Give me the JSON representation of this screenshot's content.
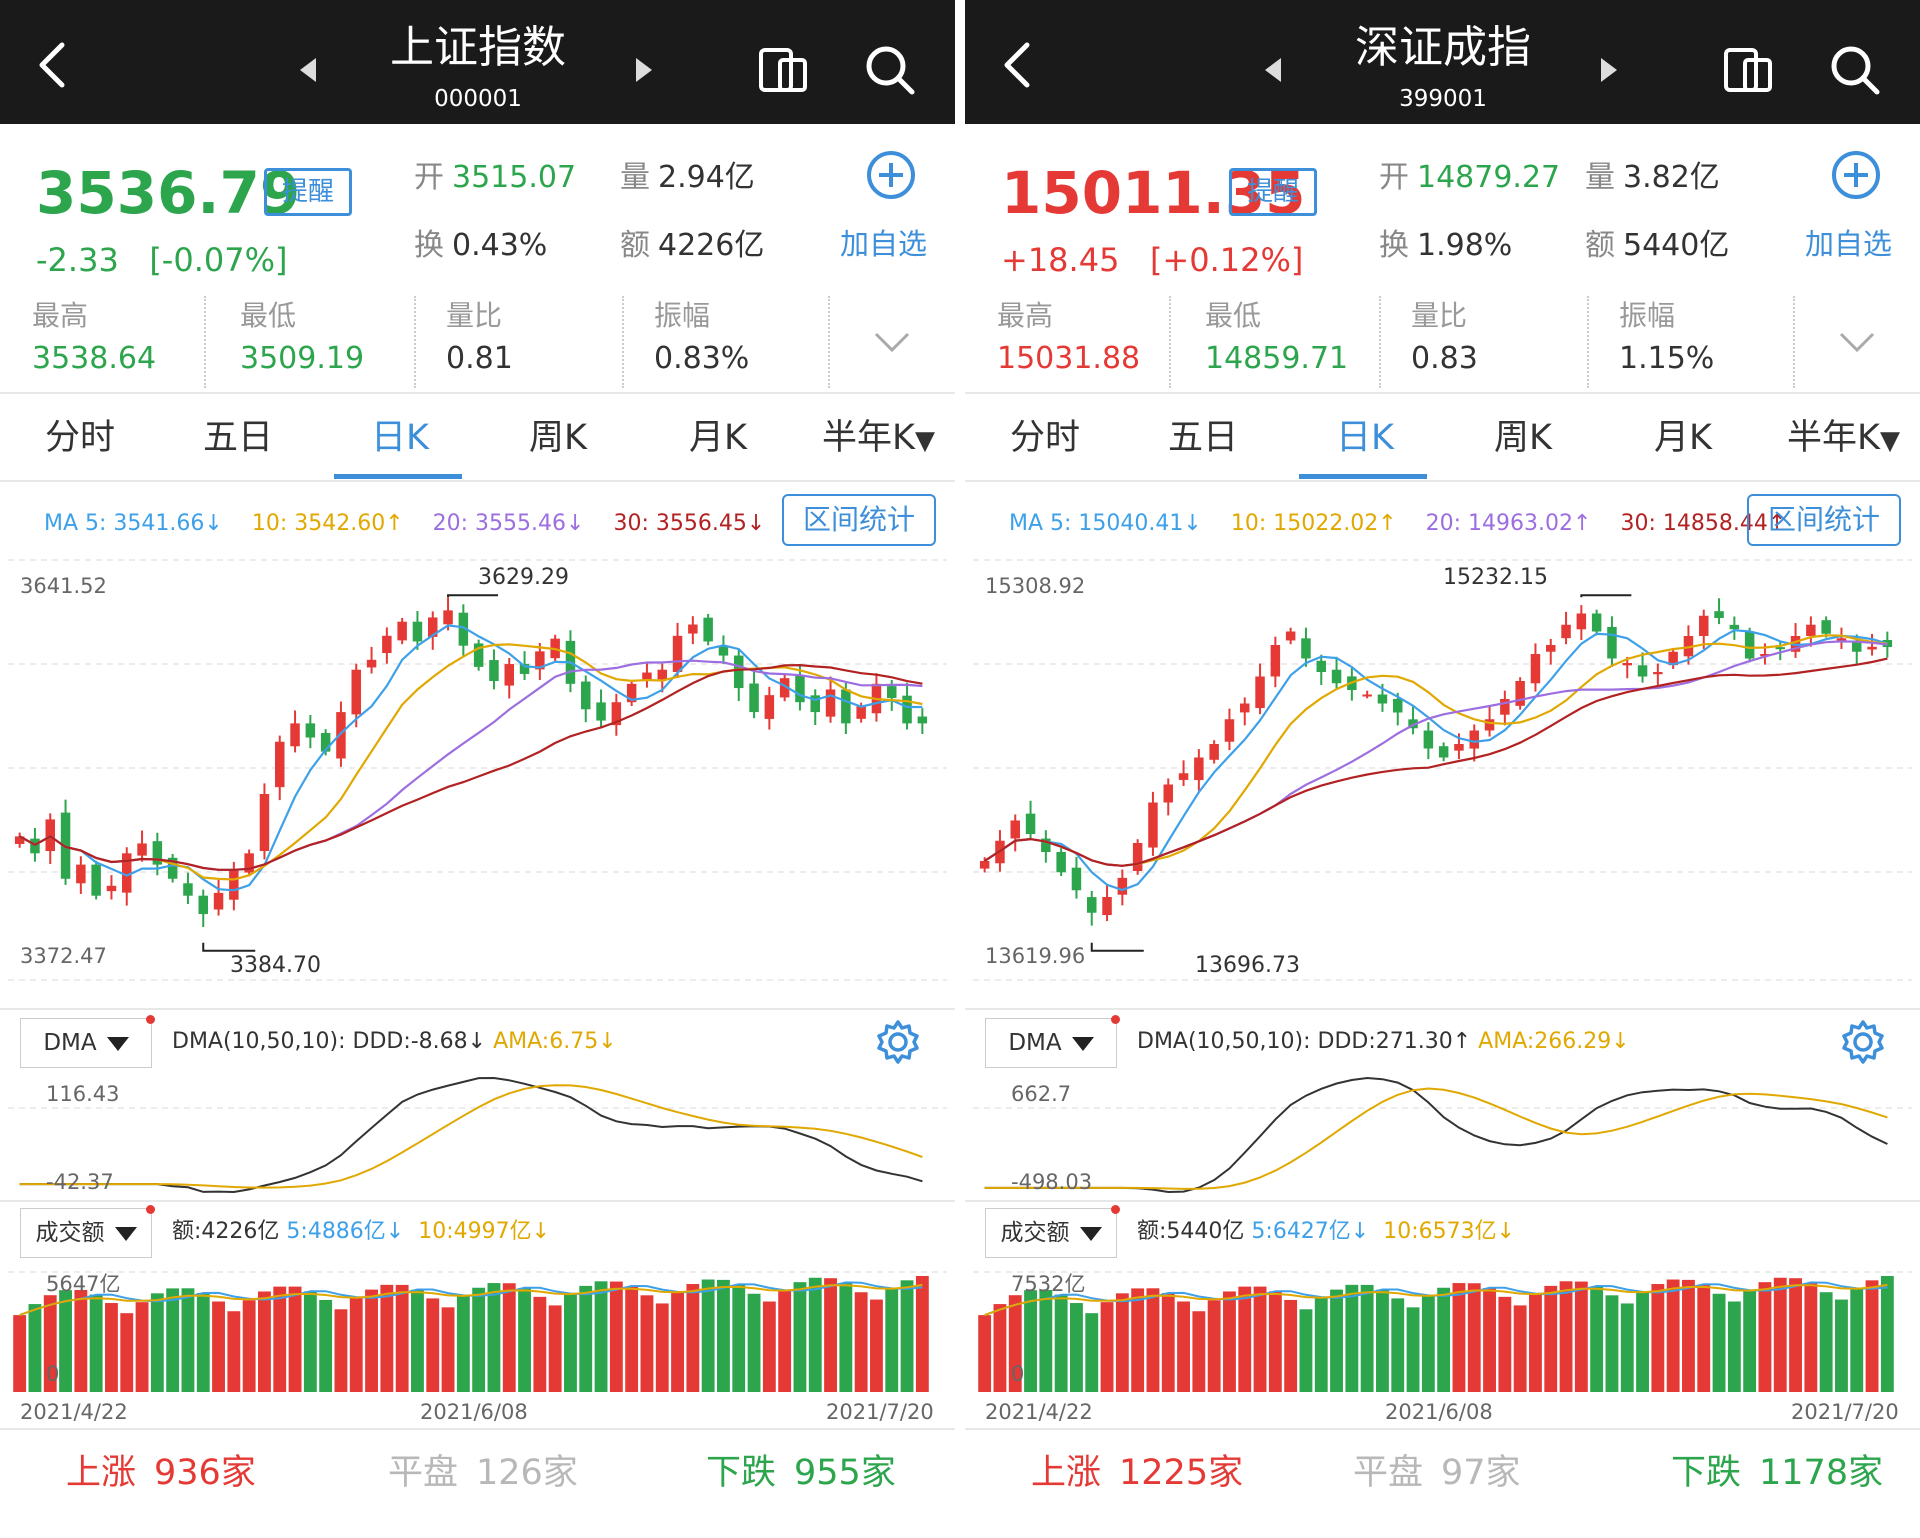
{
  "colors": {
    "up": "#e53935",
    "down": "#2ca54d",
    "accent": "#3d8fd9",
    "ma5": "#3da0e8",
    "ma10": "#e0a800",
    "ma20": "#9c6ee0",
    "ma30": "#b22222"
  },
  "panels": [
    {
      "name": "上证指数",
      "code": "000001",
      "price": "3536.79",
      "direction": "down",
      "change": "-2.33",
      "change_pct": "[-0.07%]",
      "remind_label": "提醒",
      "open_k": "开",
      "open_v": "3515.07",
      "vol_k": "量",
      "vol_v": "2.94亿",
      "turn_k": "换",
      "turn_v": "0.43%",
      "amt_k": "额",
      "amt_v": "4226亿",
      "add_label": "加自选",
      "stats": [
        {
          "label": "最高",
          "value": "3538.64",
          "dir": "down"
        },
        {
          "label": "最低",
          "value": "3509.19",
          "dir": "down"
        },
        {
          "label": "量比",
          "value": "0.81",
          "dir": "flat"
        },
        {
          "label": "振幅",
          "value": "0.83%",
          "dir": "flat"
        }
      ],
      "tabs": [
        "分时",
        "五日",
        "日K",
        "周K",
        "月K",
        "半年K"
      ],
      "active_tab": "日K",
      "ma": {
        "ma5": "MA 5: 3541.66↓",
        "ma10": "10: 3542.60↑",
        "ma20": "20: 3555.46↓",
        "ma30": "30: 3556.45↓"
      },
      "range_label": "区间统计",
      "axis_high": "3641.52",
      "axis_low": "3372.47",
      "annot_high": "3629.29",
      "annot_low": "3384.70",
      "dma_select": "DMA",
      "dma_text": "DMA(10,50,10): DDD:-8.68↓",
      "ama_text": "AMA:6.75↓",
      "dma_top": "116.43",
      "dma_bottom": "-42.37",
      "vol_select": "成交额",
      "vol_amt": "额:4226亿",
      "vol_5": "5:4886亿↓",
      "vol_10": "10:4997亿↓",
      "vol_top": "5647亿",
      "vol_zero": "0",
      "dates": [
        "2021/4/22",
        "2021/6/08",
        "2021/7/20"
      ],
      "rise_label": "上涨",
      "rise_count": "936家",
      "flat_label": "平盘",
      "flat_count": "126家",
      "fall_label": "下跌",
      "fall_count": "955家"
    },
    {
      "name": "深证成指",
      "code": "399001",
      "price": "15011.35",
      "direction": "up",
      "change": "+18.45",
      "change_pct": "[+0.12%]",
      "remind_label": "提醒",
      "open_k": "开",
      "open_v": "14879.27",
      "vol_k": "量",
      "vol_v": "3.82亿",
      "turn_k": "换",
      "turn_v": "1.98%",
      "amt_k": "额",
      "amt_v": "5440亿",
      "add_label": "加自选",
      "stats": [
        {
          "label": "最高",
          "value": "15031.88",
          "dir": "up"
        },
        {
          "label": "最低",
          "value": "14859.71",
          "dir": "down"
        },
        {
          "label": "量比",
          "value": "0.83",
          "dir": "flat"
        },
        {
          "label": "振幅",
          "value": "1.15%",
          "dir": "flat"
        }
      ],
      "tabs": [
        "分时",
        "五日",
        "日K",
        "周K",
        "月K",
        "半年K"
      ],
      "active_tab": "日K",
      "ma": {
        "ma5": "MA 5: 15040.41↓",
        "ma10": "10: 15022.02↑",
        "ma20": "20: 14963.02↑",
        "ma30": "30: 14858.44↑"
      },
      "range_label": "区间统计",
      "axis_high": "15308.92",
      "axis_low": "13619.96",
      "annot_high": "15232.15",
      "annot_low": "13696.73",
      "dma_select": "DMA",
      "dma_text": "DMA(10,50,10): DDD:271.30↑",
      "ama_text": "AMA:266.29↓",
      "dma_top": "662.7",
      "dma_bottom": "-498.03",
      "vol_select": "成交额",
      "vol_amt": "额:5440亿",
      "vol_5": "5:6427亿↓",
      "vol_10": "10:6573亿↓",
      "vol_top": "7532亿",
      "vol_zero": "0",
      "dates": [
        "2021/4/22",
        "2021/6/08",
        "2021/7/20"
      ],
      "rise_label": "上涨",
      "rise_count": "1225家",
      "flat_label": "平盘",
      "flat_count": "97家",
      "fall_label": "下跌",
      "fall_count": "1178家"
    }
  ],
  "chart_data": [
    {
      "type": "candlestick",
      "title": "上证指数 日K",
      "ylim": [
        3372.47,
        3641.52
      ],
      "marked_high": 3629.29,
      "marked_low": 3384.7,
      "x_range": [
        "2021/4/22",
        "2021/7/20"
      ],
      "closes": [
        3460,
        3448,
        3472,
        3430,
        3440,
        3418,
        3425,
        3448,
        3455,
        3440,
        3430,
        3418,
        3405,
        3420,
        3436,
        3448,
        3490,
        3527,
        3540,
        3530,
        3520,
        3548,
        3578,
        3585,
        3602,
        3612,
        3598,
        3615,
        3620,
        3595,
        3580,
        3570,
        3582,
        3575,
        3591,
        3600,
        3568,
        3550,
        3542,
        3555,
        3568,
        3576,
        3578,
        3602,
        3610,
        3598,
        3588,
        3565,
        3548,
        3560,
        3572,
        3555,
        3548,
        3564,
        3540,
        3552,
        3568,
        3558,
        3540,
        3540
      ],
      "ma": {
        "MA5": 3541.66,
        "MA10": 3542.6,
        "MA20": 3555.46,
        "MA30": 3556.45
      },
      "dma": {
        "DDD": -8.68,
        "AMA": 6.75,
        "range": [
          -42.37,
          116.43
        ]
      },
      "turnover": {
        "amount": "4226亿",
        "MA5": "4886亿",
        "MA10": "4997亿",
        "max": "5647亿"
      }
    },
    {
      "type": "candlestick",
      "title": "深证成指 日K",
      "ylim": [
        13619.96,
        15308.92
      ],
      "marked_high": 15232.15,
      "marked_low": 13696.73,
      "x_range": [
        "2021/4/22",
        "2021/7/20"
      ],
      "closes": [
        14060,
        14150,
        14240,
        14180,
        14100,
        14010,
        13930,
        13830,
        13900,
        13985,
        14140,
        14320,
        14400,
        14450,
        14520,
        14580,
        14690,
        14760,
        14880,
        15020,
        15080,
        14960,
        14900,
        14850,
        14820,
        14800,
        14760,
        14720,
        14650,
        14560,
        14520,
        14580,
        14640,
        14690,
        14780,
        14860,
        14980,
        15020,
        15110,
        15160,
        15080,
        14960,
        14940,
        14880,
        14900,
        14990,
        15060,
        15150,
        15140,
        15090,
        14960,
        14980,
        15010,
        15060,
        15110,
        15070,
        15050,
        14990,
        15012,
        15011
      ]
    }
  ]
}
